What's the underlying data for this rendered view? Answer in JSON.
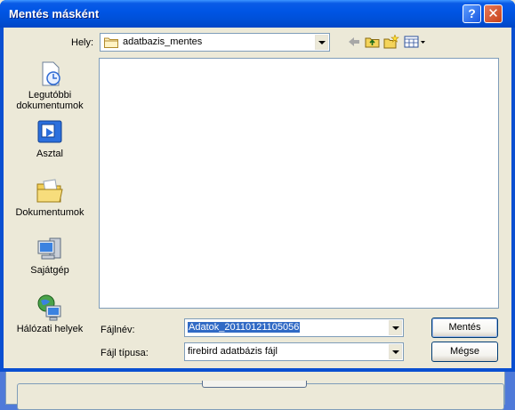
{
  "dialog": {
    "title": "Mentés másként",
    "help_label": "?",
    "close_label": "✕"
  },
  "lookin": {
    "label": "Hely:",
    "value": "adatbazis_mentes",
    "icons": [
      "back-arrow-icon",
      "up-folder-icon",
      "new-folder-icon",
      "view-menu-icon"
    ]
  },
  "places": [
    {
      "label": "Legutóbbi dokumentumok",
      "icon": "recent-documents-icon"
    },
    {
      "label": "Asztal",
      "icon": "desktop-icon"
    },
    {
      "label": "Dokumentumok",
      "icon": "my-documents-icon"
    },
    {
      "label": "Sajátgép",
      "icon": "my-computer-icon"
    },
    {
      "label": "Hálózati helyek",
      "icon": "network-places-icon"
    }
  ],
  "filename": {
    "label": "Fájlnév:",
    "value": "Adatok_20110121105056"
  },
  "filetype": {
    "label": "Fájl típusa:",
    "value": "firebird adatbázis fájl"
  },
  "buttons": {
    "save": "Mentés",
    "cancel": "Mégse"
  },
  "colors": {
    "titlebar": "#0055e5",
    "selection": "#316ac5",
    "dialog_bg": "#ece9d8"
  }
}
